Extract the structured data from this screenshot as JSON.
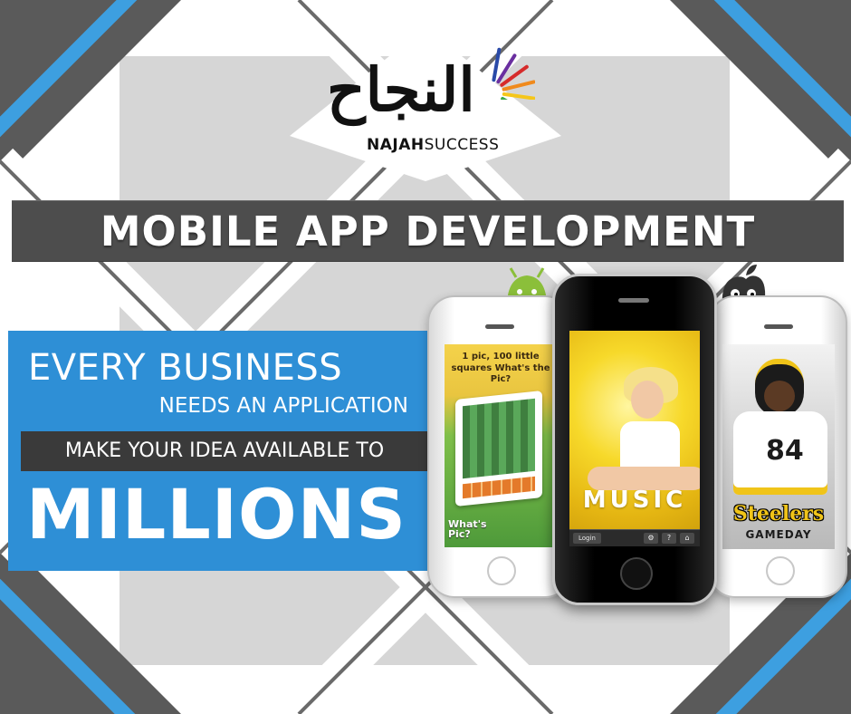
{
  "logo": {
    "arabic": "النجاح",
    "word_bold": "NAJAH",
    "word_light": "SUCCESS",
    "ray_colors": [
      "#2a4aa8",
      "#6a2fa0",
      "#d62b2b",
      "#f08a1c",
      "#f5c61a",
      "#3aa84a"
    ]
  },
  "banner": {
    "headline": "MOBILE APP DEVELOPMENT"
  },
  "promo": {
    "line1": "EVERY BUSINESS",
    "line2": "NEEDS AN APPLICATION",
    "line3": "MAKE YOUR IDEA AVAILABLE TO",
    "line4": "MILLIONS"
  },
  "phones": {
    "left": {
      "screen_title": "1 pic, 100 little squares What's the Pic?",
      "screen_brand_line1": "What's",
      "screen_brand_line2": "Pic?"
    },
    "center": {
      "screen_word": "MUSIC",
      "toolbar_login": "Login",
      "toolbar_icons": [
        "⚙",
        "?",
        "⌂"
      ]
    },
    "right": {
      "jersey_number": "84",
      "brand": "Steelers",
      "subbrand": "GAMEDAY"
    }
  },
  "colors": {
    "accent_blue": "#2e8fd6",
    "banner_gray": "#4d4d4d",
    "frame_blue": "#3d9fe0",
    "frame_gray": "#5a5a5a",
    "panel_gray": "#d6d6d6"
  },
  "icons": {
    "android": "android-mascot-icon",
    "apple": "apple-mascot-icon"
  }
}
